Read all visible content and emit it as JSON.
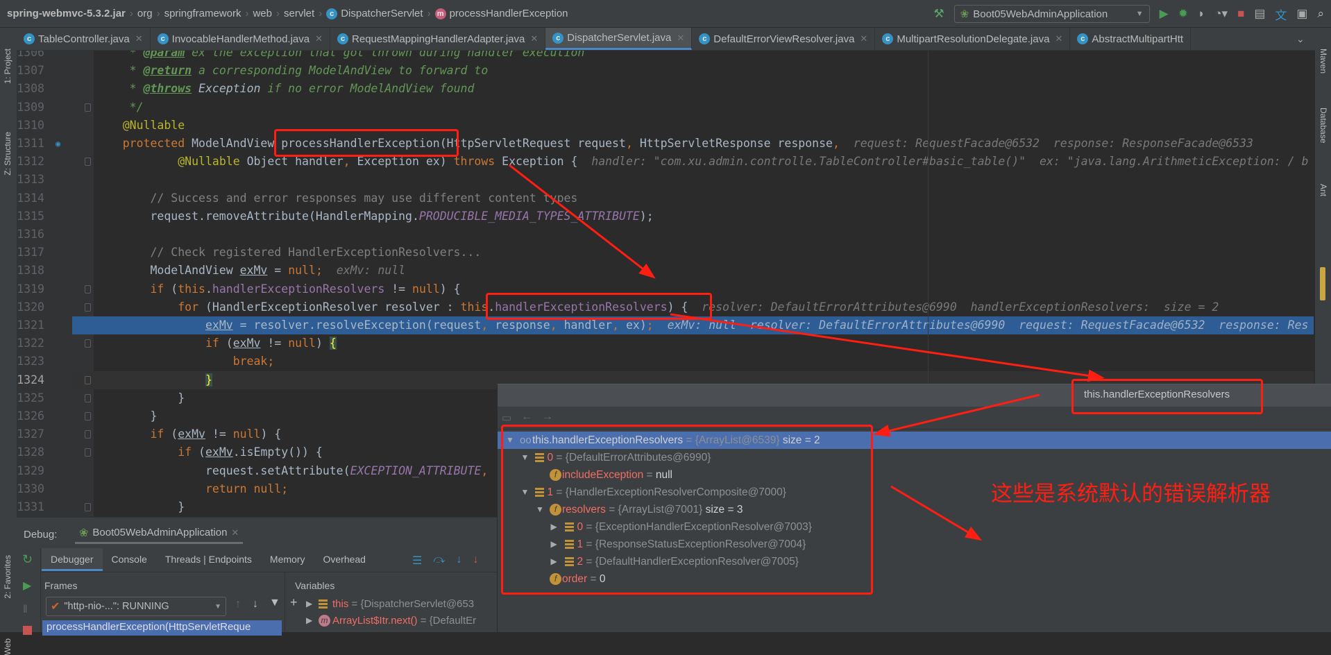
{
  "breadcrumb": [
    {
      "label": "spring-webmvc-5.3.2.jar",
      "bold": true
    },
    {
      "label": "org"
    },
    {
      "label": "springframework"
    },
    {
      "label": "web"
    },
    {
      "label": "servlet"
    },
    {
      "label": "DispatcherServlet",
      "icon": "class-icon"
    },
    {
      "label": "processHandlerException",
      "icon": "method-icon"
    }
  ],
  "toolbar": {
    "run_config": "Boot05WebAdminApplication",
    "icons": [
      "build-hammer-icon",
      "run-icon",
      "debug-icon",
      "coverage-icon",
      "profiler-icon",
      "stop-icon",
      "project-structure-icon",
      "translate-icon",
      "terminal-icon",
      "search-icon"
    ]
  },
  "tabs": [
    {
      "label": "TableController.java"
    },
    {
      "label": "InvocableHandlerMethod.java"
    },
    {
      "label": "RequestMappingHandlerAdapter.java"
    },
    {
      "label": "DispatcherServlet.java",
      "active": true
    },
    {
      "label": "DefaultErrorViewResolver.java"
    },
    {
      "label": "MultipartResolutionDelegate.java"
    },
    {
      "label": "AbstractMultipartHtt"
    }
  ],
  "left_strip": {
    "project": "1: Project",
    "structure": "Z: Structure",
    "favorites": "2: Favorites",
    "web": "Web"
  },
  "right_strip": {
    "maven": "Maven",
    "database": "Database",
    "ant": "Ant"
  },
  "editor": {
    "execution_line": 1321,
    "caret_line": 1324,
    "lines": [
      {
        "n": 1306,
        "t": [
          [
            "     * ",
            "doc"
          ],
          [
            "@param",
            "tag"
          ],
          [
            " ex the exception that got thrown during handler execution",
            "doc"
          ]
        ]
      },
      {
        "n": 1307,
        "t": [
          [
            "     * ",
            "doc"
          ],
          [
            "@return",
            "tag"
          ],
          [
            " a corresponding ModelAndView to forward to",
            "doc"
          ]
        ]
      },
      {
        "n": 1308,
        "t": [
          [
            "     * ",
            "doc"
          ],
          [
            "@throws",
            "tag"
          ],
          [
            " ",
            "doc"
          ],
          [
            "Exception",
            "docr"
          ],
          [
            " if no error ModelAndView found",
            "doc"
          ]
        ]
      },
      {
        "n": 1309,
        "t": [
          [
            "     */",
            "doc"
          ]
        ]
      },
      {
        "n": 1310,
        "t": [
          [
            "    ",
            ""
          ],
          [
            "@Nullable",
            "ann"
          ]
        ]
      },
      {
        "n": 1311,
        "t": [
          [
            "    ",
            ""
          ],
          [
            "protected ",
            "kw"
          ],
          [
            "ModelAndView processHandlerException(HttpServletRequest request",
            ""
          ],
          [
            ", ",
            "kw"
          ],
          [
            "HttpServletResponse response",
            ""
          ],
          [
            ",  ",
            "kw"
          ],
          [
            "request: RequestFacade@6532  response: ResponseFacade@6533",
            "hint"
          ]
        ]
      },
      {
        "n": 1312,
        "t": [
          [
            "            ",
            ""
          ],
          [
            "@Nullable ",
            "ann"
          ],
          [
            "Object handler",
            ""
          ],
          [
            ", ",
            "kw"
          ],
          [
            "Exception ex) ",
            ""
          ],
          [
            "throws ",
            "kw"
          ],
          [
            "Exception {  ",
            ""
          ],
          [
            "handler: \"com.xu.admin.controlle.TableController#basic_table()\"  ex: \"java.lang.ArithmeticException: / b",
            "hint"
          ]
        ]
      },
      {
        "n": 1313,
        "t": []
      },
      {
        "n": 1314,
        "t": [
          [
            "        // Success and error responses may use different content types",
            "cm"
          ]
        ]
      },
      {
        "n": 1315,
        "t": [
          [
            "        request.removeAttribute(HandlerMapping.",
            ""
          ],
          [
            "PRODUCIBLE_MEDIA_TYPES_ATTRIBUTE",
            "cst"
          ],
          [
            ");",
            ""
          ]
        ]
      },
      {
        "n": 1316,
        "t": []
      },
      {
        "n": 1317,
        "t": [
          [
            "        // Check registered HandlerExceptionResolvers...",
            "cm"
          ]
        ]
      },
      {
        "n": 1318,
        "t": [
          [
            "        ModelAndView ",
            ""
          ],
          [
            "exMv",
            "u"
          ],
          [
            " = ",
            ""
          ],
          [
            "null",
            "kw"
          ],
          [
            ";",
            "kw"
          ],
          [
            "  exMv: null",
            "hint"
          ]
        ]
      },
      {
        "n": 1319,
        "t": [
          [
            "        ",
            ""
          ],
          [
            "if ",
            "kw"
          ],
          [
            "(",
            ""
          ],
          [
            "this",
            "kw"
          ],
          [
            ".",
            ""
          ],
          [
            "handlerExceptionResolvers",
            "fld"
          ],
          [
            " != ",
            ""
          ],
          [
            "null",
            "kw"
          ],
          [
            ") {",
            ""
          ]
        ]
      },
      {
        "n": 1320,
        "t": [
          [
            "            ",
            ""
          ],
          [
            "for ",
            "kw"
          ],
          [
            "(HandlerExceptionResolver resolver : ",
            ""
          ],
          [
            "this",
            "kw"
          ],
          [
            ".",
            ""
          ],
          [
            "handlerExceptionResolvers",
            "fld"
          ],
          [
            ") {  ",
            ""
          ],
          [
            "resolver: DefaultErrorAttributes@6990  handlerExceptionResolvers:  size = 2",
            "hint"
          ]
        ]
      },
      {
        "n": 1321,
        "t": [
          [
            "                ",
            ""
          ],
          [
            "exMv",
            "u"
          ],
          [
            " = resolver.resolveException(request",
            ""
          ],
          [
            ", ",
            "kw"
          ],
          [
            "response",
            ""
          ],
          [
            ", ",
            "kw"
          ],
          [
            "handler",
            ""
          ],
          [
            ", ",
            "kw"
          ],
          [
            "ex)",
            ""
          ],
          [
            ";",
            "kw"
          ],
          [
            "  exMv: null  resolver: DefaultErrorAttributes@6990  request: RequestFacade@6532  response: Res",
            "hint"
          ]
        ]
      },
      {
        "n": 1322,
        "t": [
          [
            "                ",
            ""
          ],
          [
            "if ",
            "kw"
          ],
          [
            "(",
            ""
          ],
          [
            "exMv",
            "u"
          ],
          [
            " != ",
            ""
          ],
          [
            "null",
            "kw"
          ],
          [
            ") ",
            ""
          ],
          [
            "{",
            "br"
          ]
        ]
      },
      {
        "n": 1323,
        "t": [
          [
            "                    ",
            ""
          ],
          [
            "break",
            "kw"
          ],
          [
            ";",
            "kw"
          ]
        ]
      },
      {
        "n": 1324,
        "t": [
          [
            "                ",
            ""
          ],
          [
            "}",
            "br"
          ]
        ]
      },
      {
        "n": 1325,
        "t": [
          [
            "            }",
            ""
          ]
        ]
      },
      {
        "n": 1326,
        "t": [
          [
            "        }",
            ""
          ]
        ]
      },
      {
        "n": 1327,
        "t": [
          [
            "        ",
            ""
          ],
          [
            "if ",
            "kw"
          ],
          [
            "(",
            ""
          ],
          [
            "exMv",
            "u"
          ],
          [
            " != ",
            ""
          ],
          [
            "null",
            "kw"
          ],
          [
            ") {",
            ""
          ]
        ]
      },
      {
        "n": 1328,
        "t": [
          [
            "            ",
            ""
          ],
          [
            "if ",
            "kw"
          ],
          [
            "(",
            ""
          ],
          [
            "exMv",
            "u"
          ],
          [
            ".isEmpty()) {",
            ""
          ]
        ]
      },
      {
        "n": 1329,
        "t": [
          [
            "                request.setAttribute(",
            ""
          ],
          [
            "EXCEPTION_ATTRIBUTE",
            "cst"
          ],
          [
            ", ",
            "kw"
          ]
        ]
      },
      {
        "n": 1330,
        "t": [
          [
            "                ",
            ""
          ],
          [
            "return null",
            "kw"
          ],
          [
            ";",
            "kw"
          ]
        ]
      },
      {
        "n": 1331,
        "t": [
          [
            "            }",
            ""
          ]
        ]
      }
    ]
  },
  "debug": {
    "label": "Debug:",
    "session": "Boot05WebAdminApplication",
    "tabs": [
      "Debugger",
      "Console",
      "Threads | Endpoints",
      "Memory",
      "Overhead"
    ],
    "frames_header": "Frames",
    "variables_header": "Variables",
    "thread": "\"http-nio-...\": RUNNING",
    "frame": "processHandlerException(HttpServletReque",
    "variables": [
      {
        "name": "this",
        "value": " = {DispatcherServlet@653"
      },
      {
        "name": "ArrayList$Itr.next()",
        "value": " = {DefaultEr"
      }
    ]
  },
  "popup": {
    "title": "this.handlerExceptionResolvers",
    "rows": [
      {
        "level": 0,
        "arrow": "open",
        "icon": "watch-glasses-icon",
        "name": "this.handlerExceptionResolvers",
        "plainname": true,
        "value": " = {ArrayList@6539}",
        "extra": "  size = 2",
        "selected": true
      },
      {
        "level": 1,
        "arrow": "open",
        "icon": "list-icon",
        "name": "0",
        "value": " = {DefaultErrorAttributes@6990}"
      },
      {
        "level": 2,
        "arrow": "none",
        "icon": "field-icon",
        "name": "includeException",
        "value": " = ",
        "extra": "null"
      },
      {
        "level": 1,
        "arrow": "open",
        "icon": "list-icon",
        "name": "1",
        "value": " = {HandlerExceptionResolverComposite@7000}"
      },
      {
        "level": 2,
        "arrow": "open",
        "icon": "field-icon",
        "name": "resolvers",
        "value": " = {ArrayList@7001}",
        "extra": "  size = 3"
      },
      {
        "level": 3,
        "arrow": "closed",
        "icon": "list-icon",
        "name": "0",
        "value": " = {ExceptionHandlerExceptionResolver@7003}"
      },
      {
        "level": 3,
        "arrow": "closed",
        "icon": "list-icon",
        "name": "1",
        "value": " = {ResponseStatusExceptionResolver@7004}"
      },
      {
        "level": 3,
        "arrow": "closed",
        "icon": "list-icon",
        "name": "2",
        "value": " = {DefaultHandlerExceptionResolver@7005}"
      },
      {
        "level": 2,
        "arrow": "none",
        "icon": "field-icon",
        "name": "order",
        "value": " = ",
        "extra": "0"
      }
    ]
  },
  "annotation": {
    "note": "这些是系统默认的错误解析器",
    "color": "#ff1e12"
  }
}
